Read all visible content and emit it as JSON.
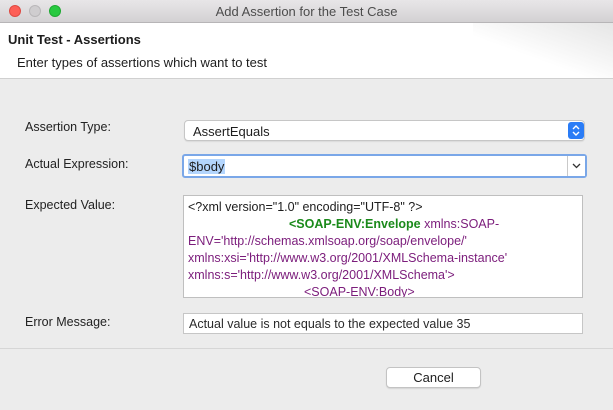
{
  "window": {
    "title": "Add Assertion for the Test Case"
  },
  "banner": {
    "title": "Unit Test - Assertions",
    "subtitle": "Enter types of assertions which want to test"
  },
  "form": {
    "assertion_type": {
      "label": "Assertion Type:",
      "value": "AssertEquals"
    },
    "actual_expression": {
      "label": "Actual Expression:",
      "value": "$body"
    },
    "expected_value": {
      "label": "Expected Value:",
      "lines": [
        {
          "plain": "<?xml version=\"1.0\" encoding=\"UTF-8\" ?>"
        },
        {
          "tag": "<SOAP-ENV:Envelope",
          "attr": " xmlns:SOAP-"
        },
        {
          "attr": "ENV='http://schemas.xmlsoap.org/soap/envelope/'"
        },
        {
          "attr": "xmlns:xsi='http://www.w3.org/2001/XMLSchema-instance'"
        },
        {
          "attr": "xmlns:s='http://www.w3.org/2001/XMLSchema'>"
        },
        {
          "attr": "<SOAP-ENV:Body>"
        }
      ]
    },
    "error_message": {
      "label": "Error Message:",
      "value": "Actual value is not equals to the expected value 35"
    }
  },
  "buttons": {
    "cancel": "Cancel"
  },
  "colors": {
    "accent": "#2a7cf6",
    "selection": "#b3d5fd",
    "xml_tag": "#1b8a1b",
    "xml_attr": "#7b1c7b"
  },
  "icons": {
    "assertion_type_control": "up-down-chevron-icon",
    "actual_expression_control": "chevron-down-icon"
  }
}
